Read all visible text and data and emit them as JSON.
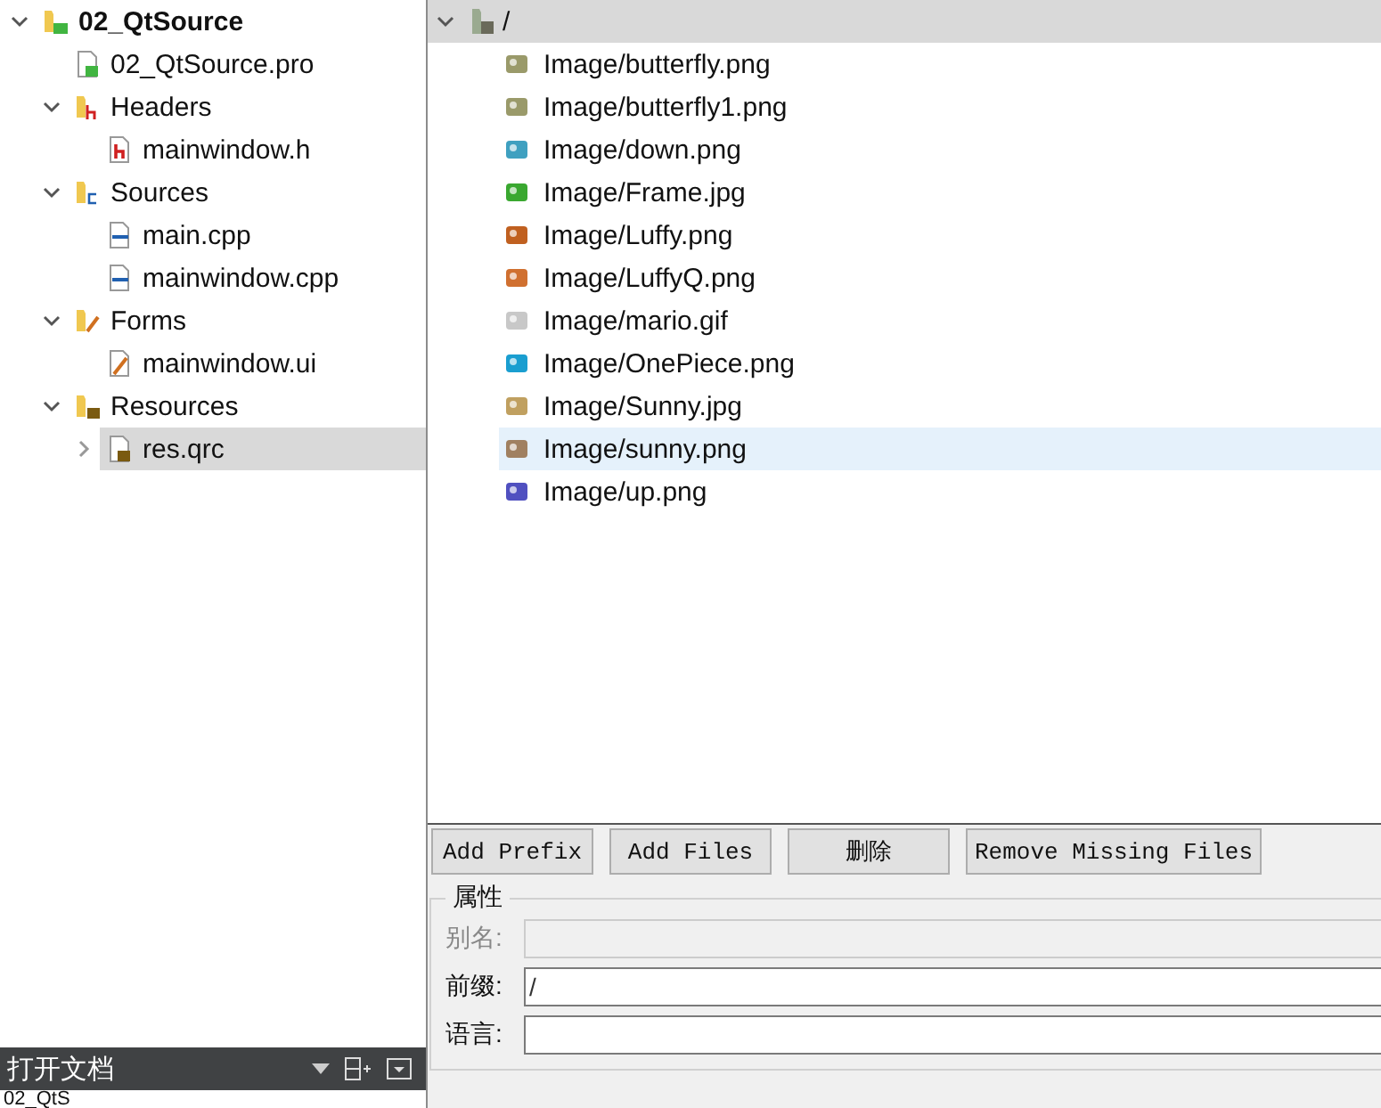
{
  "project_tree": [
    {
      "label": "02_QtSource",
      "kind": "project",
      "expanded": true,
      "selected": false,
      "children": [
        {
          "label": "02_QtSource.pro",
          "kind": "pro-file",
          "selected": false
        },
        {
          "label": "Headers",
          "kind": "header-folder",
          "expanded": true,
          "selected": false,
          "children": [
            {
              "label": "mainwindow.h",
              "kind": "header-file",
              "selected": false
            }
          ]
        },
        {
          "label": "Sources",
          "kind": "source-folder",
          "expanded": true,
          "selected": false,
          "children": [
            {
              "label": "main.cpp",
              "kind": "source-file",
              "selected": false
            },
            {
              "label": "mainwindow.cpp",
              "kind": "source-file",
              "selected": false
            }
          ]
        },
        {
          "label": "Forms",
          "kind": "form-folder",
          "expanded": true,
          "selected": false,
          "children": [
            {
              "label": "mainwindow.ui",
              "kind": "form-file",
              "selected": false
            }
          ]
        },
        {
          "label": "Resources",
          "kind": "resource-folder",
          "expanded": true,
          "selected": false,
          "children": [
            {
              "label": "res.qrc",
              "kind": "resource-file",
              "expanded": false,
              "selected": true
            }
          ]
        }
      ]
    }
  ],
  "open_documents": {
    "title": "打开文档",
    "items": [
      "02_QtS"
    ]
  },
  "resource_tree": {
    "prefix": {
      "label": "/",
      "expanded": true,
      "selected": true
    },
    "files": [
      {
        "label": "Image/butterfly.png",
        "hovered": false
      },
      {
        "label": "Image/butterfly1.png",
        "hovered": false
      },
      {
        "label": "Image/down.png",
        "hovered": false
      },
      {
        "label": "Image/Frame.jpg",
        "hovered": false
      },
      {
        "label": "Image/Luffy.png",
        "hovered": false
      },
      {
        "label": "Image/LuffyQ.png",
        "hovered": false
      },
      {
        "label": "Image/mario.gif",
        "hovered": false
      },
      {
        "label": "Image/OnePiece.png",
        "hovered": false
      },
      {
        "label": "Image/Sunny.jpg",
        "hovered": false
      },
      {
        "label": "Image/sunny.png",
        "hovered": true
      },
      {
        "label": "Image/up.png",
        "hovered": false
      }
    ]
  },
  "buttons": [
    "Add Prefix",
    "Add Files",
    "删除",
    "Remove Missing Files"
  ],
  "properties": {
    "title": "属性",
    "fields": [
      {
        "label": "别名:",
        "disabled": true
      },
      {
        "label": "前缀:",
        "value": "/",
        "disabled": false
      },
      {
        "label": "语言:",
        "disabled": false
      }
    ]
  }
}
